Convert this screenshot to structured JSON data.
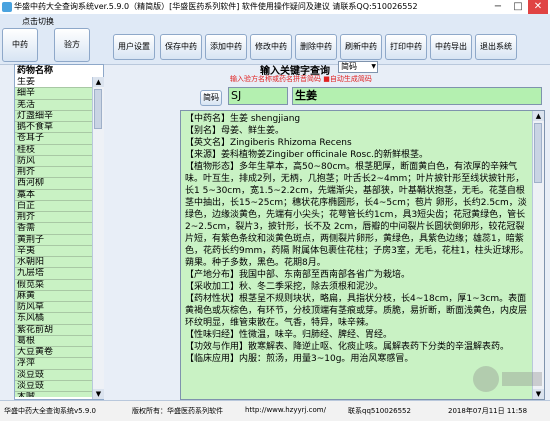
{
  "titlebar": {
    "title": "华盛中药大全查询系统ver.5.9.0（精简版）[华盛医药系列软件] 软件使用操作疑问及建议 请联系QQ:510026552",
    "minimize": "−",
    "maximize": "□",
    "close": "✕"
  },
  "toolbar": {
    "hint": "点击切换",
    "left_buttons": [
      "中药",
      "验方"
    ],
    "buttons": [
      "用户设置",
      "保存中药",
      "添加中药",
      "修改中药",
      "删除中药",
      "刷新中药",
      "打印中药",
      "中药导出",
      "退出系统"
    ]
  },
  "sidebar": {
    "header": "药物名称",
    "items": [
      "生姜",
      "细辛",
      "羌活",
      "灯盏细辛",
      "鹅不食草",
      "苍耳子",
      "桂枝",
      "防风",
      "荆芥",
      "西河柳",
      "藁本",
      "白芷",
      "荆芥",
      "香薷",
      "黄荆子",
      "辛夷",
      "水朝阳",
      "九层塔",
      "假苋菜",
      "麻黄",
      "防风草",
      "东风橘",
      "紫花前胡",
      "葛根",
      "大豆黄卷",
      "浮萍",
      "淡豆豉",
      "淡豆豉",
      "木贼"
    ],
    "scroll_up": "▲",
    "scroll_down": "▼"
  },
  "search": {
    "label": "输入关键字查询",
    "mode": "简码",
    "note": "输入验方名称或药名拼音简码     ■自动生成简码"
  },
  "detail": {
    "code_label": "简码",
    "code_value": "SJ",
    "name": "生姜"
  },
  "content": {
    "paragraphs": [
      "【中药名】生姜 shengjiang",
      "【别名】母姜、鲜生姜。",
      "【英文名】Zingiberis Rhizoma Recens",
      "【来源】姜科植物姜Zingiber officinale Rosc.的新鲜根茎。",
      "【植物形态】多年生草本，高50~80cm。根茎肥厚，断面黄白色，有浓厚的辛辣气味。叶互生，排成2列，无柄，几抱茎；叶舌长2~4mm；叶片披针形至线状披针形，长1 5~30cm，宽1.5~2.2cm，先端渐尖，基部狭，叶基鞘状抱茎，无毛。花茎自根茎中抽出，长15~25cm；穗状花序椭圆形，长4~5cm；苞片 卵形，长约2.5cm，淡绿色，边缘淡黄色，先端有小尖头；花萼管长约1cm，具3短尖齿；花冠黄绿色，管长2~2.5cm，裂片3，披针形，长不及 2cm，唇瓣的中间裂片长圆状倒卵形，较花冠裂片短，有紫色条纹和淡黄色斑点，两侧裂片卵形，黄绿色，具紫色边缘；雄蕊1，暗紫色，花药长约9mm，药隔 附属体包裹住花柱；子房3室，无毛，花柱1，柱头近球形。蒴果。种子多数，黑色。花期8月。",
      "【产地分布】我国中部、东南部至西南部各省广为栽培。",
      "【采收加工】秋、冬二季采挖，除去须根和泥沙。",
      "【药材性状】根茎呈不规则块状，略扁，具指状分枝，长4~18cm，厚1~3cm。表面黄褐色或灰棕色，有环节，分枝顶端有茎痕或芽。质脆，易折断，断面浅黄色，内皮层环纹明显，维管束散在。气香，特异，味辛辣。",
      "【性味归经】性微温，味辛。归肺经、脾经、胃经。",
      "【功效与作用】散寒解表、降逆止呕、化痰止咳。属解表药下分类的辛温解表药。",
      "【临床应用】内服：煎汤，用量3~10g。用治风寒感冒。"
    ],
    "scroll_up": "▲",
    "scroll_down": "▼"
  },
  "status": {
    "version": "华盛中药大全查询系统v5.9.0",
    "copyright": "版权所有：华盛医药系列软件",
    "url": "http://www.hzyyrj.com/",
    "contact": "联系qq510026552",
    "date": "2018年07月11日 11:58"
  },
  "colors": {
    "list_green": "#c9f2c4",
    "content_green": "#b4f0b0",
    "note_red": "#e02020"
  }
}
